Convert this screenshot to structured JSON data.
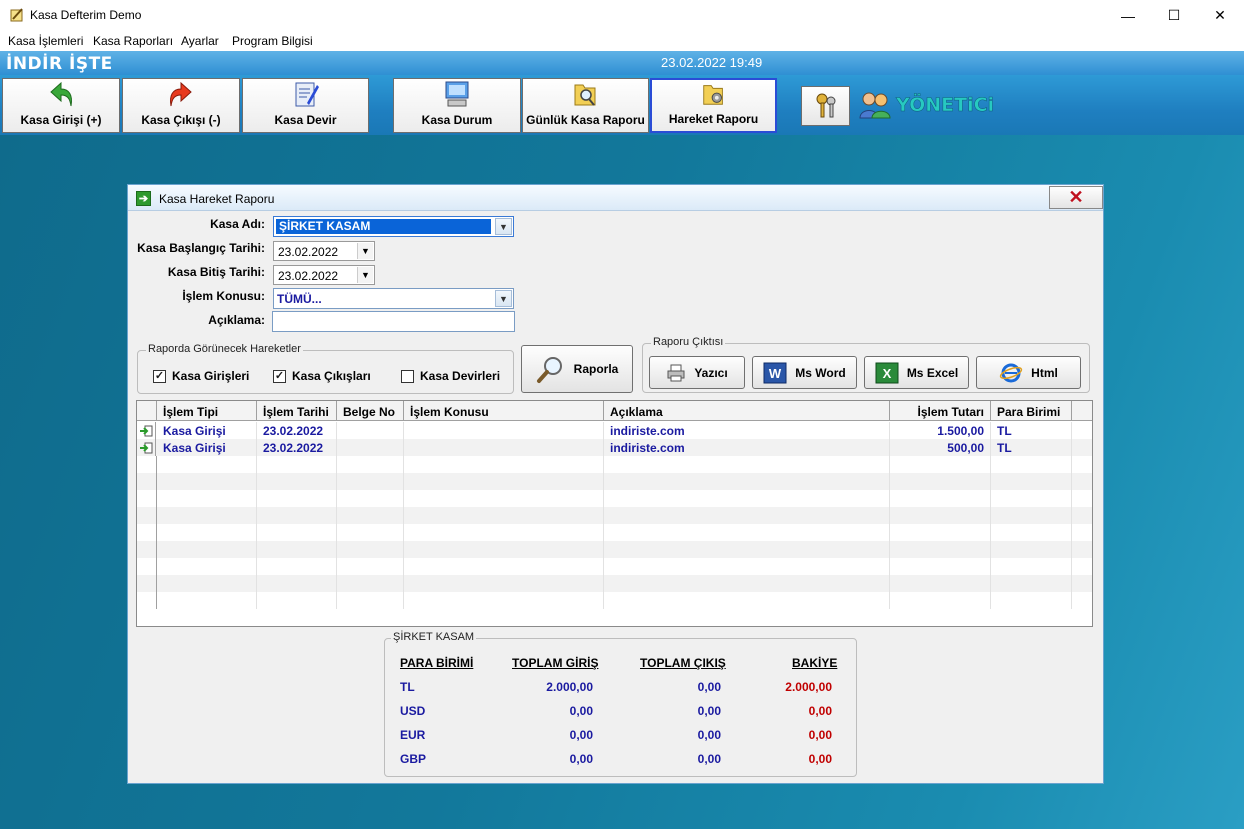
{
  "window": {
    "title": "Kasa Defterim Demo",
    "min": "—",
    "max": "☐",
    "close": "✕"
  },
  "menu": [
    "Kasa İşlemleri",
    "Kasa Raporları",
    "Ayarlar",
    "Program Bilgisi"
  ],
  "header": {
    "brand": "İNDİR İŞTE",
    "datetime": "23.02.2022 19:49"
  },
  "toolbar": {
    "kasa_girisi": "Kasa Girişi  (+)",
    "kasa_cikisi": "Kasa Çıkışı (-)",
    "kasa_devir": "Kasa Devir",
    "kasa_durum": "Kasa Durum",
    "gunluk_rapor": "Günlük Kasa Raporu",
    "hareket_raporu": "Hareket Raporu",
    "admin_label": "YÖNETiCi"
  },
  "dialog": {
    "title": "Kasa Hareket Raporu",
    "fields": {
      "kasa_adi_label": "Kasa Adı:",
      "kasa_adi_value": "ŞİRKET KASAM",
      "baslangic_label": "Kasa Başlangıç Tarihi:",
      "baslangic_value": "23.02.2022",
      "bitis_label": "Kasa Bitiş Tarihi:",
      "bitis_value": "23.02.2022",
      "konu_label": "İşlem Konusu:",
      "konu_value": "TÜMÜ...",
      "aciklama_label": "Açıklama:",
      "aciklama_value": ""
    },
    "hareketler": {
      "label": "Raporda Görünecek Hareketler",
      "girisler": "Kasa Girişleri",
      "cikislar": "Kasa Çıkışları",
      "devirler": "Kasa Devirleri"
    },
    "raporla": "Raporla",
    "cikti": {
      "label": "Raporu Çıktısı",
      "yazici": "Yazıcı",
      "word": "Ms Word",
      "excel": "Ms Excel",
      "html": "Html"
    },
    "grid": {
      "columns": [
        "İşlem Tipi",
        "İşlem Tarihi",
        "Belge No",
        "İşlem Konusu",
        "Açıklama",
        "İşlem Tutarı",
        "Para Birimi"
      ],
      "rows": [
        {
          "tip": "Kasa Girişi",
          "tarih": "23.02.2022",
          "belge": "",
          "konu": "",
          "aciklama": "indiriste.com",
          "tutar": "1.500,00",
          "birim": "TL"
        },
        {
          "tip": "Kasa Girişi",
          "tarih": "23.02.2022",
          "belge": "",
          "konu": "",
          "aciklama": "indiriste.com",
          "tutar": "500,00",
          "birim": "TL"
        }
      ]
    },
    "summary": {
      "label": "ŞİRKET KASAM",
      "headers": [
        "PARA BİRİMİ",
        "TOPLAM GİRİŞ",
        "TOPLAM ÇIKIŞ",
        "BAKİYE"
      ],
      "rows": [
        {
          "birim": "TL",
          "giris": "2.000,00",
          "cikis": "0,00",
          "bakiye": "2.000,00"
        },
        {
          "birim": "USD",
          "giris": "0,00",
          "cikis": "0,00",
          "bakiye": "0,00"
        },
        {
          "birim": "EUR",
          "giris": "0,00",
          "cikis": "0,00",
          "bakiye": "0,00"
        },
        {
          "birim": "GBP",
          "giris": "0,00",
          "cikis": "0,00",
          "bakiye": "0,00"
        }
      ]
    }
  },
  "colors": {
    "accent_blue": "#1a1aa0",
    "bakiye_red": "#c00000",
    "admin_teal": "#27c9c0"
  }
}
